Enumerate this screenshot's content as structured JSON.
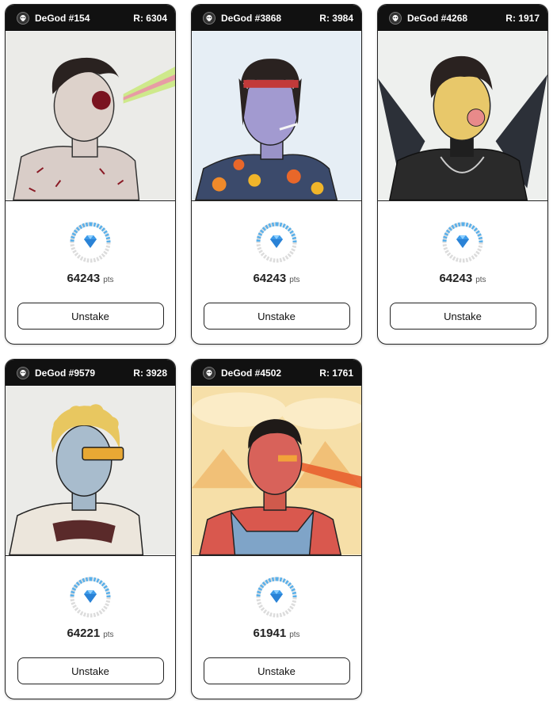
{
  "cards": [
    {
      "name": "DeGod #154",
      "rank": "R: 6304",
      "points": "64243",
      "unit": "pts",
      "button": "Unstake",
      "bg": "#ebebe8"
    },
    {
      "name": "DeGod #3868",
      "rank": "R: 3984",
      "points": "64243",
      "unit": "pts",
      "button": "Unstake",
      "bg": "#e6eef5"
    },
    {
      "name": "DeGod #4268",
      "rank": "R: 1917",
      "points": "64243",
      "unit": "pts",
      "button": "Unstake",
      "bg": "#eef0ee"
    },
    {
      "name": "DeGod #9579",
      "rank": "R: 3928",
      "points": "64221",
      "unit": "pts",
      "button": "Unstake",
      "bg": "#ebebe8"
    },
    {
      "name": "DeGod #4502",
      "rank": "R: 1761",
      "points": "61941",
      "unit": "pts",
      "button": "Unstake",
      "bg": "#f6dfa8"
    }
  ],
  "colors": {
    "header": "#111111",
    "ring_active": "#5ab0ea",
    "ring_inactive": "#dcdcdc",
    "diamond": "#3d9be9"
  }
}
